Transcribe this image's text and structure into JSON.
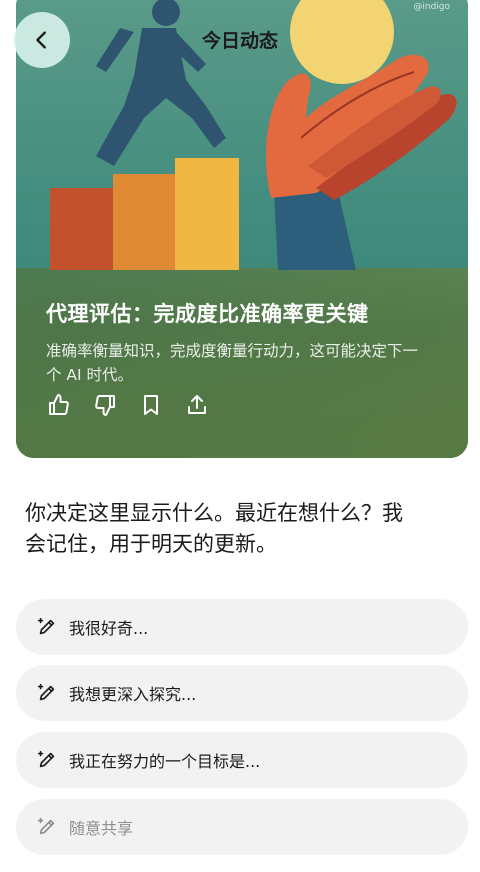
{
  "header": {
    "title": "今日动态",
    "back_icon": "chevron-left-icon"
  },
  "card": {
    "watermark": "@indigo",
    "title": "代理评估：完成度比准确率更关键",
    "subtitle": "准确率衡量知识，完成度衡量行动力，这可能决定下一个 AI 时代。",
    "actions": [
      {
        "name": "thumbs-up-icon"
      },
      {
        "name": "thumbs-down-icon"
      },
      {
        "name": "bookmark-icon"
      },
      {
        "name": "share-icon"
      }
    ]
  },
  "prompt": {
    "text": "你决定这里显示什么。最近在想什么？我会记住，用于明天的更新。"
  },
  "suggestions": [
    {
      "label": "我很好奇...",
      "icon": "pencil-sparkle-icon"
    },
    {
      "label": "我想更深入探究...",
      "icon": "pencil-sparkle-icon"
    },
    {
      "label": "我正在努力的一个目标是...",
      "icon": "pencil-sparkle-icon"
    },
    {
      "label": "随意共享",
      "icon": "pencil-sparkle-icon"
    }
  ],
  "colors": {
    "card_background": "#4f8d7c",
    "suggestion_background": "#f2f2f2",
    "back_button_background": "#d6f0e8"
  }
}
